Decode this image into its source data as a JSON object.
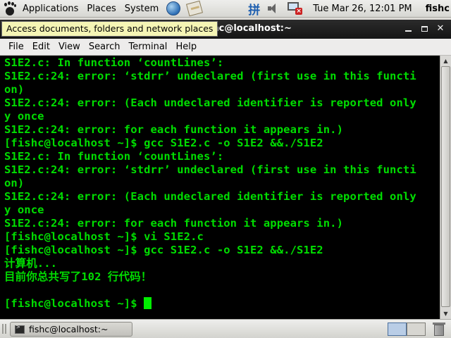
{
  "top_panel": {
    "menus": [
      "Applications",
      "Places",
      "System"
    ],
    "launchers": [
      "web-browser-icon",
      "text-editor-icon"
    ],
    "tray": {
      "ime_label": "拼",
      "clock": "Tue Mar 26, 12:01 PM",
      "user": "fishc"
    }
  },
  "tooltip": "Access documents, folders and network places",
  "window": {
    "title": "fishc@localhost:~",
    "controls": {
      "minimize": "–",
      "maximize": "□",
      "close": "✕"
    },
    "menu": [
      "File",
      "Edit",
      "View",
      "Search",
      "Terminal",
      "Help"
    ]
  },
  "terminal": {
    "lines": [
      "S1E2.c: In function ‘countLines’:",
      "S1E2.c:24: error: ‘stdrr’ undeclared (first use in this functi",
      "on)",
      "S1E2.c:24: error: (Each undeclared identifier is reported only",
      "y once",
      "S1E2.c:24: error: for each function it appears in.)",
      "[fishc@localhost ~]$ gcc S1E2.c -o S1E2 &&./S1E2",
      "S1E2.c: In function ‘countLines’:",
      "S1E2.c:24: error: ‘stdrr’ undeclared (first use in this functi",
      "on)",
      "S1E2.c:24: error: (Each undeclared identifier is reported only",
      "y once",
      "S1E2.c:24: error: for each function it appears in.)",
      "[fishc@localhost ~]$ vi S1E2.c",
      "[fishc@localhost ~]$ gcc S1E2.c -o S1E2 &&./S1E2",
      "计算机...",
      "目前你总共写了102 行代码！",
      "",
      "[fishc@localhost ~]$ "
    ]
  },
  "taskbar": {
    "task_label": "fishc@localhost:~"
  },
  "colors": {
    "terminal_fg": "#00dd00",
    "terminal_bg": "#000000",
    "tooltip_bg": "#f5f5b5"
  }
}
